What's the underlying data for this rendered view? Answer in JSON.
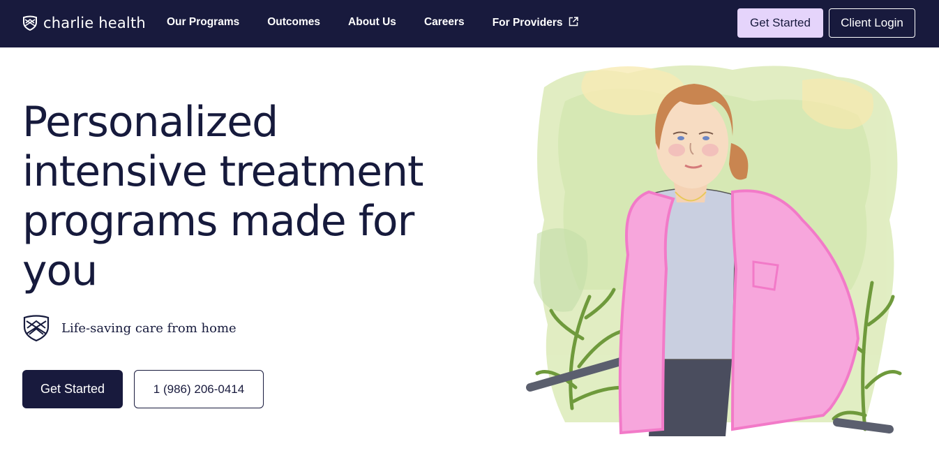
{
  "brand": {
    "name": "charlie health"
  },
  "nav": {
    "links": [
      "Our Programs",
      "Outcomes",
      "About Us",
      "Careers",
      "For Providers"
    ],
    "get_started": "Get Started",
    "client_login": "Client Login"
  },
  "hero": {
    "headline": "Personalized intensive treatment programs made for you",
    "tagline": "Life-saving care from home",
    "cta_primary": "Get Started",
    "cta_phone": "1 (986) 206-0414"
  },
  "colors": {
    "nav_bg": "#181a3d",
    "nav_cta_bg": "#e5d4fb",
    "text_dark": "#161a3c",
    "jacket_pink": "#f27ac8",
    "wash_green": "#cfe3a8"
  },
  "icons": {
    "logo": "shield-logo-icon",
    "external": "external-link-icon",
    "tagline": "shield-crest-icon"
  }
}
